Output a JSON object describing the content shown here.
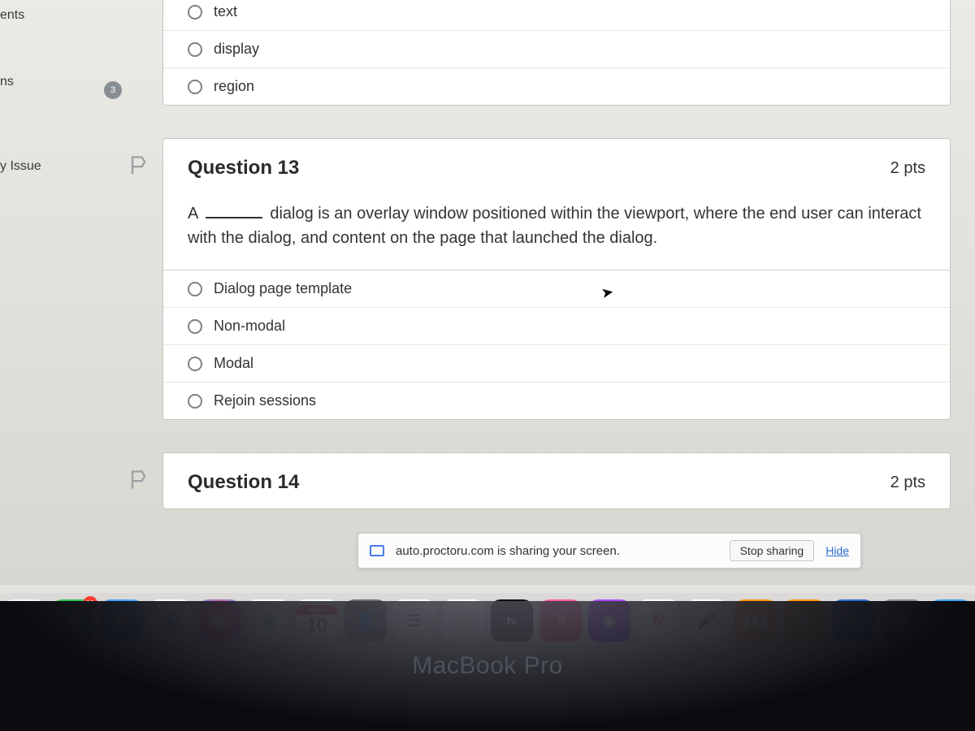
{
  "sidebar": {
    "items": [
      "ents",
      "ns",
      "y Issue"
    ],
    "badge": "3"
  },
  "question_prev": {
    "options": [
      "text",
      "display",
      "region"
    ]
  },
  "question13": {
    "title": "Question 13",
    "pts": "2 pts",
    "text_prefix": "A ",
    "text_suffix": " dialog is an overlay window positioned within the viewport, where the end user can interact with the dialog, and content on the page that launched the dialog.",
    "options": [
      "Dialog page template",
      "Non-modal",
      "Modal",
      "Rejoin sessions"
    ]
  },
  "question14": {
    "title": "Question 14",
    "pts": "2 pts"
  },
  "share": {
    "message": "auto.proctoru.com is sharing your screen.",
    "stop": "Stop sharing",
    "hide": "Hide"
  },
  "dock": {
    "calendar": {
      "month": "MAY",
      "day": "10"
    },
    "messages_badge": "11"
  },
  "footer": "MacBook Pro"
}
